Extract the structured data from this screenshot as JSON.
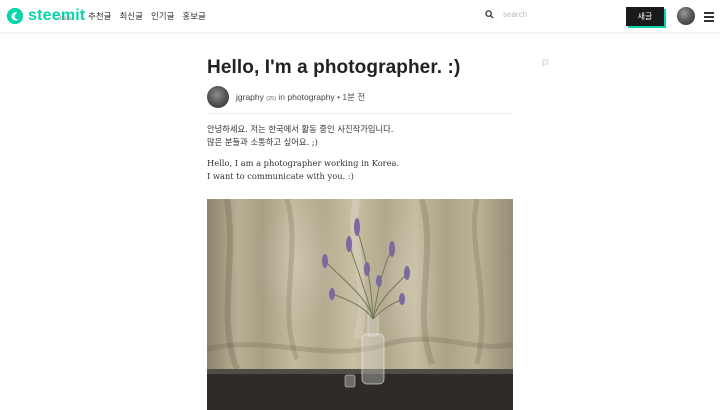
{
  "header": {
    "logo_text": "steemit",
    "logo_beta": "beta",
    "nav": [
      "추천글",
      "최신글",
      "인기글",
      "홍보글"
    ],
    "search_placeholder": "search",
    "write_button": "새글",
    "brand_color": "#06d6a9",
    "icons": [
      "steemit-logo-icon",
      "search-icon",
      "user-avatar",
      "hamburger-menu-icon"
    ]
  },
  "post": {
    "title": "Hello, I'm a photographer. :)",
    "author": "jgraphy",
    "reputation": "(25)",
    "in_label": "in",
    "category": "photography",
    "separator": "•",
    "time": "1분 전",
    "body": [
      "안녕하세요. 저는 한국에서 활동 중인 사진작가입니다.",
      "많은 분들과 소통하고 싶어요. ;)",
      "Hello, I am a photographer working in Korea.",
      "I want to communicate with you. :)"
    ],
    "image_alt": "Photo of dried lavender in a glass bottle against a beige draped cloth"
  }
}
